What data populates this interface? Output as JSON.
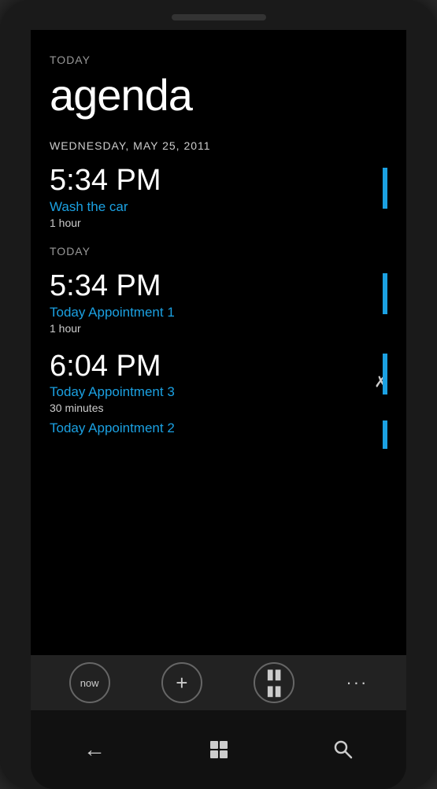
{
  "phone": {
    "header": {
      "today_label": "TODAY",
      "title": "agenda"
    },
    "date": "WEDNESDAY, MAY 25, 2011",
    "sections": [
      {
        "label": null,
        "appointments": [
          {
            "time": "5:34 PM",
            "title": "Wash the car",
            "duration": "1 hour",
            "has_bar": true
          }
        ]
      },
      {
        "label": "TODAY",
        "appointments": [
          {
            "time": "5:34 PM",
            "title": "Today Appointment 1",
            "duration": "1 hour",
            "has_bar": true,
            "has_collapse": false
          },
          {
            "time": "6:04 PM",
            "title": "Today Appointment 3",
            "duration": "30 minutes",
            "has_bar": true,
            "has_collapse": true,
            "stacked_title": "Today Appointment 2",
            "stacked_has_bar": true
          }
        ]
      }
    ],
    "toolbar": {
      "now_label": "now",
      "add_label": "+",
      "calendar_label": "📅",
      "more_label": "···"
    },
    "nav": {
      "back_label": "←",
      "home_label": "⊞",
      "search_label": "⚲"
    }
  }
}
